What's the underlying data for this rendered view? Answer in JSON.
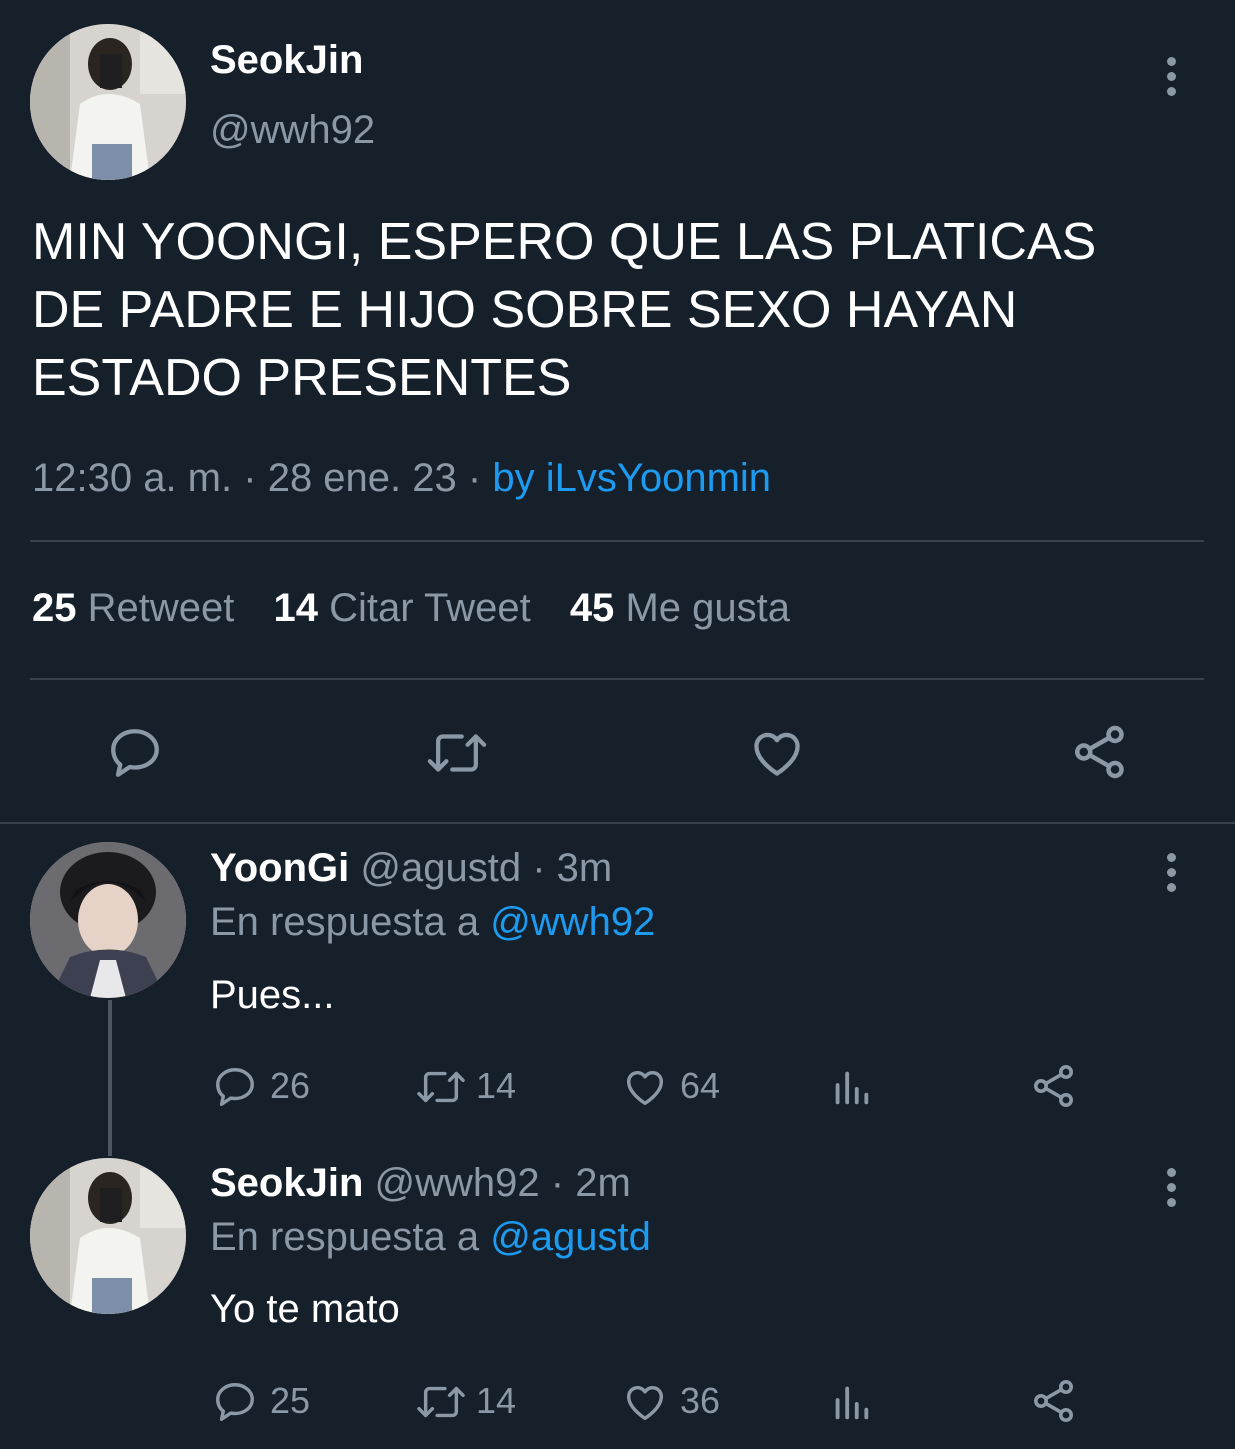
{
  "main_tweet": {
    "display_name": "SeokJin",
    "handle": "@wwh92",
    "text_lines": [
      "MIN YOONGI, ESPERO QUE LAS PLATICAS",
      "DE PADRE E HIJO SOBRE SEXO HAYAN",
      "ESTADO PRESENTES"
    ],
    "time": "12:30 a. m.",
    "sep1": "·",
    "date": "28 ene. 23",
    "sep2": "·",
    "via": "by iLvsYoonmin",
    "stats": {
      "retweets_count": "25",
      "retweets_label": "Retweet",
      "quotes_count": "14",
      "quotes_label": "Citar Tweet",
      "likes_count": "45",
      "likes_label": "Me gusta"
    }
  },
  "replies": [
    {
      "display_name": "YoonGi",
      "handle": "@agustd",
      "sep": "·",
      "age": "3m",
      "reply_to_label": "En respuesta a",
      "reply_to_handle": "@wwh92",
      "text": "Pues...",
      "replies_count": "26",
      "retweets_count": "14",
      "likes_count": "64"
    },
    {
      "display_name": "SeokJin",
      "handle": "@wwh92",
      "sep": "·",
      "age": "2m",
      "reply_to_label": "En respuesta a",
      "reply_to_handle": "@agustd",
      "text": "Yo te mato",
      "replies_count": "25",
      "retweets_count": "14",
      "likes_count": "36"
    }
  ],
  "colors": {
    "background": "#15202b",
    "muted_text": "#8b98a5",
    "link": "#1d9bf0",
    "divider": "#38444d"
  },
  "icons": [
    "reply-icon",
    "retweet-icon",
    "like-icon",
    "share-icon",
    "analytics-icon",
    "more-icon"
  ]
}
